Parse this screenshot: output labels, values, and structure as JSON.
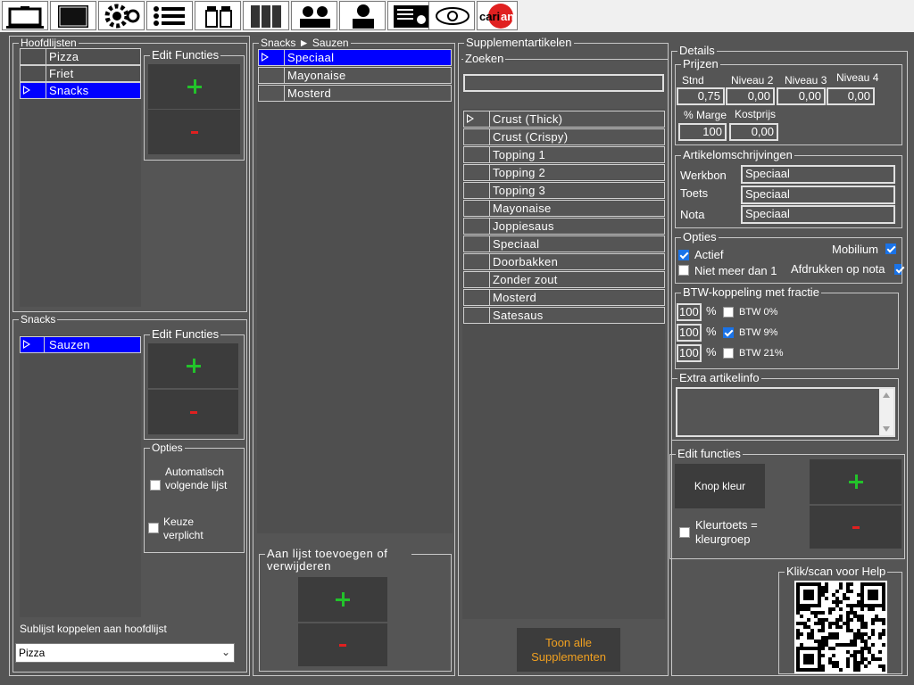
{
  "toolbar": {
    "icons": [
      "monitor-icon",
      "black-screen-icon",
      "gear-icon",
      "list-icon",
      "jars-icon",
      "binders-icon",
      "users-icon",
      "person-icon",
      "report-icon",
      "eye-icon",
      "carian-logo-icon"
    ],
    "logo_text": "carian"
  },
  "hoofdlijsten": {
    "title": "Hoofdlijsten",
    "items": [
      "Pizza",
      "Friet",
      "Snacks"
    ],
    "selected": "Snacks",
    "edit_title": "Edit Functies"
  },
  "snacks": {
    "title": "Snacks",
    "items": [
      "Sauzen"
    ],
    "edit_title": "Edit Functies",
    "opties_title": "Opties",
    "opt_auto": "Automatisch volgende lijst",
    "opt_keuze": "Keuze verplicht",
    "sublist_label": "Sublijst koppelen aan hoofdlijst",
    "sublist_value": "Pizza"
  },
  "snacks_sauzen": {
    "title": "Snacks ► Sauzen",
    "items": [
      "Speciaal",
      "Mayonaise",
      "Mosterd"
    ],
    "add_remove_title": "Aan lijst toevoegen of verwijderen"
  },
  "supplementen": {
    "title": "Supplementartikelen",
    "search_title": "Zoeken",
    "search_value": "",
    "items": [
      "Crust (Thick)",
      "Crust (Crispy)",
      "Topping 1",
      "Topping 2",
      "Topping 3",
      "Mayonaise",
      "Joppiesaus",
      "Speciaal",
      "Doorbakken",
      "Zonder zout",
      "Mosterd",
      "Satesaus"
    ],
    "show_all": "Toon alle Supplementen"
  },
  "details": {
    "title": "Details",
    "prijzen": {
      "title": "Prijzen",
      "labels": [
        "Stnd",
        "Niveau 2",
        "Niveau 3",
        "Niveau 4"
      ],
      "values": [
        "0,75",
        "0,00",
        "0,00",
        "0,00"
      ],
      "marge_label": "% Marge",
      "kostprijs_label": "Kostprijs",
      "marge_value": "100",
      "kostprijs_value": "0,00"
    },
    "omschrijvingen": {
      "title": "Artikelomschrijvingen",
      "werkbon_label": "Werkbon",
      "werkbon_value": "Speciaal",
      "toets_label": "Toets",
      "toets_value": "Speciaal",
      "nota_label": "Nota",
      "nota_value": "Speciaal"
    },
    "opties": {
      "title": "Opties",
      "actief": "Actief",
      "niet_meer": "Niet meer dan 1",
      "mobilium": "Mobilium",
      "afdrukken": "Afdrukken op nota"
    },
    "btw": {
      "title": "BTW-koppeling met fractie",
      "rows": [
        {
          "value": "100",
          "pct": "%",
          "label": "BTW  0%",
          "checked": false
        },
        {
          "value": "100",
          "pct": "%",
          "label": "BTW  9%",
          "checked": true
        },
        {
          "value": "100",
          "pct": "%",
          "label": "BTW 21%",
          "checked": false
        }
      ]
    },
    "extra_title": "Extra artikelinfo",
    "edit_title": "Edit functies",
    "knop_kleur": "Knop kleur",
    "kleurtoets": "Kleurtoets = kleurgroep",
    "help_title": "Klik/scan voor Help"
  }
}
